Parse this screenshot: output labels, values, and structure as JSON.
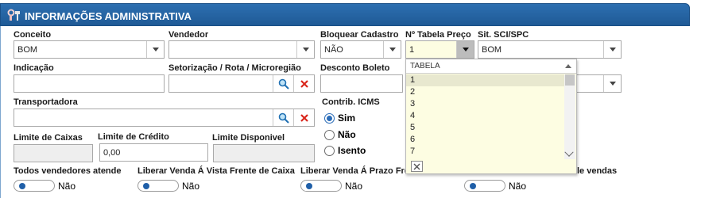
{
  "header": {
    "title": "INFORMAÇÕES ADMINISTRATIVA"
  },
  "fields": {
    "conceito": {
      "label": "Conceito",
      "value": "BOM"
    },
    "vendedor": {
      "label": "Vendedor",
      "value": ""
    },
    "bloquear_cadastro": {
      "label": "Bloquear Cadastro",
      "value": "NÃO"
    },
    "tabela_preco": {
      "label": "Nº Tabela Preço",
      "value": "1"
    },
    "sit_sci_spc": {
      "label": "Sit. SCI/SPC",
      "value": "BOM"
    },
    "indicacao": {
      "label": "Indicação",
      "value": ""
    },
    "setorizacao": {
      "label": "Setorização / Rota / Microregião",
      "value": ""
    },
    "desconto_boleto": {
      "label": "Desconto Boleto",
      "value": ""
    },
    "transportadora": {
      "label": "Transportadora",
      "value": ""
    },
    "limite_caixas": {
      "label": "Limite de Caixas",
      "value": ""
    },
    "limite_credito": {
      "label": "Limite de Crédito",
      "value": "0,00"
    },
    "limite_disponivel": {
      "label": "Limite Disponivel",
      "value": ""
    }
  },
  "contrib_icms": {
    "label": "Contrib. ICMS",
    "options": [
      {
        "label": "Sim",
        "selected": true
      },
      {
        "label": "Não",
        "selected": false
      },
      {
        "label": "Isento",
        "selected": false
      }
    ]
  },
  "toggles": [
    {
      "label": "Todos vendedores atende",
      "state": "Não"
    },
    {
      "label": "Liberar Venda Á Vista Frente de Caixa",
      "state": "Não"
    },
    {
      "label": "Liberar Venda Á Prazo Fre",
      "state": "Não"
    },
    {
      "label": "le vendas",
      "state": "Não"
    }
  ],
  "dropdown": {
    "column_header": "TABELA",
    "items": [
      "1",
      "2",
      "3",
      "4",
      "5",
      "6",
      "7"
    ],
    "selected": "1"
  },
  "colors": {
    "header_blue": "#2563a3",
    "dropdown_bg": "#fdfde2",
    "accent": "#2a6cb8"
  }
}
